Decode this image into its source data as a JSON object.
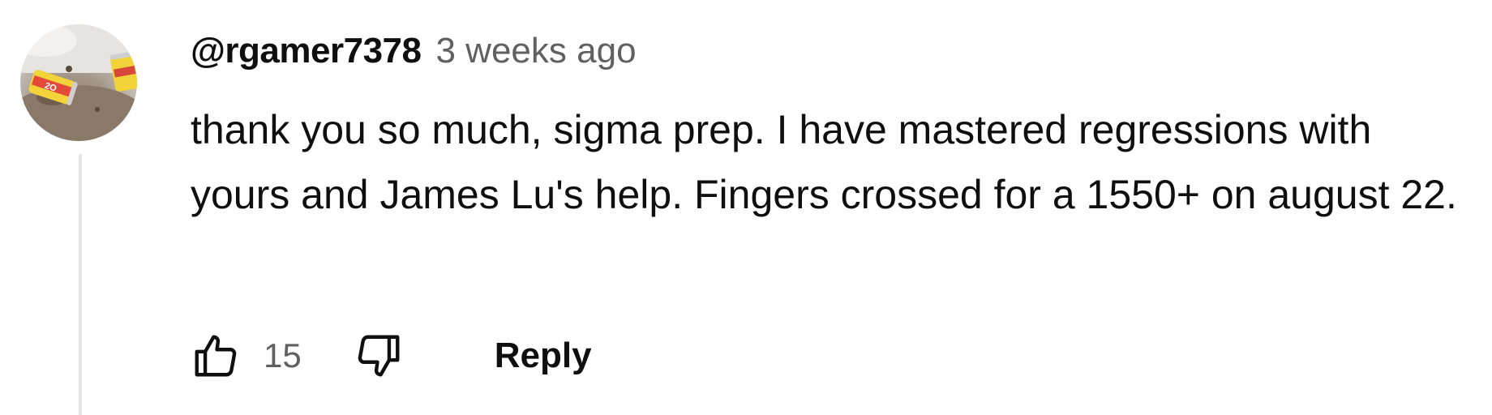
{
  "comment": {
    "author": "@rgamer7378",
    "timestamp": "3 weeks ago",
    "text": "thank you so much, sigma prep. I have mastered regressions with yours and James Lu's help. Fingers crossed for a 1550+ on august 22.",
    "like_count": "15",
    "reply_label": "Reply"
  },
  "icons": {
    "like": "thumbs-up-icon",
    "dislike": "thumbs-down-icon"
  },
  "colors": {
    "primary_text": "#0f0f0f",
    "secondary_text": "#606060",
    "thread_line": "#e5e5e5"
  }
}
